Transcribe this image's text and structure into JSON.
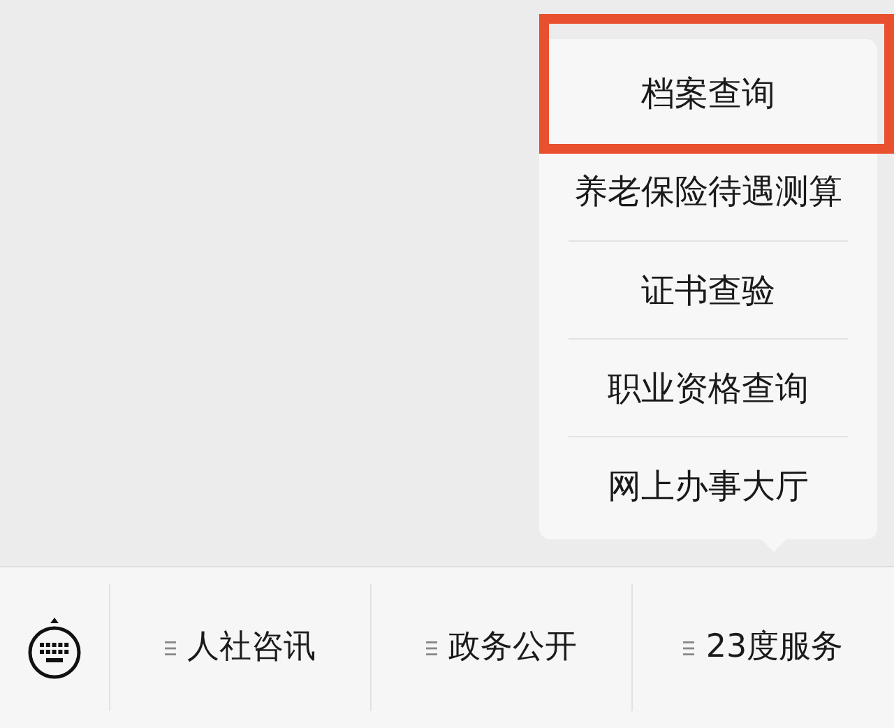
{
  "popup_menu": {
    "items": [
      {
        "label": "档案查询",
        "highlighted": true
      },
      {
        "label": "养老保险待遇测算",
        "highlighted": false
      },
      {
        "label": "证书查验",
        "highlighted": false
      },
      {
        "label": "职业资格查询",
        "highlighted": false
      },
      {
        "label": "网上办事大厅",
        "highlighted": false
      }
    ]
  },
  "bottom_menu": {
    "tabs": [
      {
        "label": "人社咨讯"
      },
      {
        "label": "政务公开"
      },
      {
        "label": "23度服务"
      }
    ]
  }
}
